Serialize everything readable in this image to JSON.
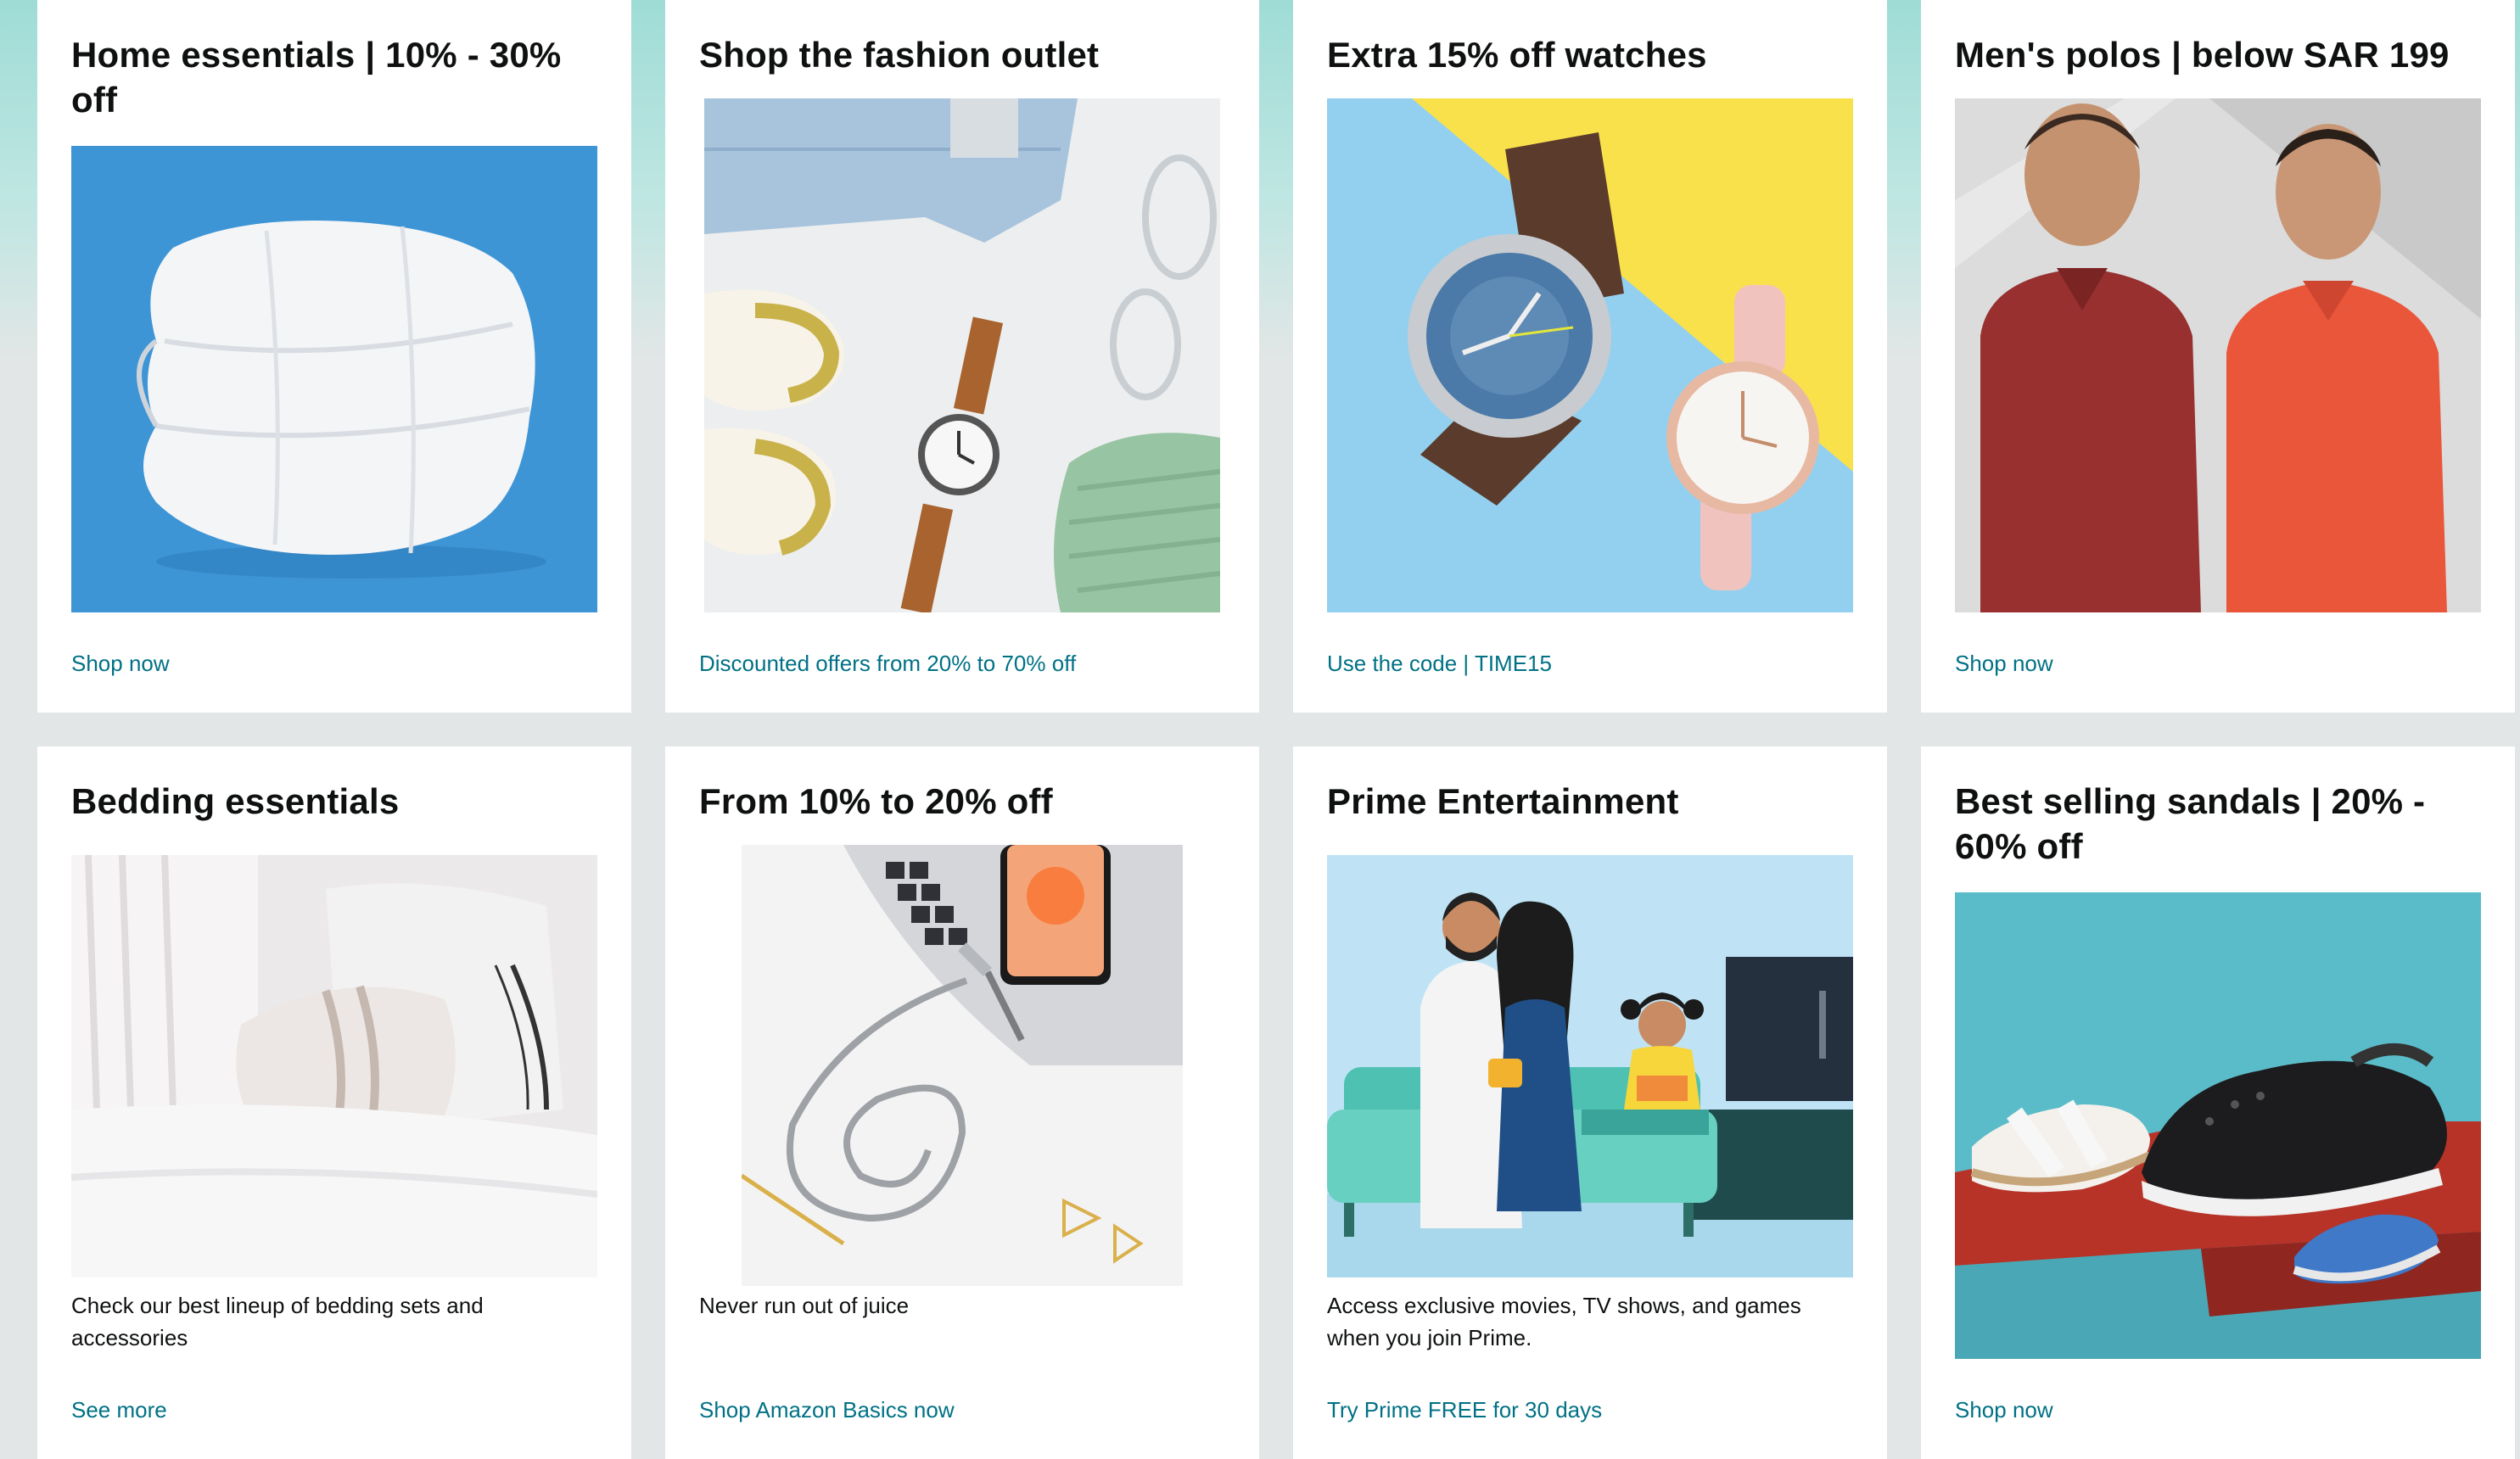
{
  "cards": [
    {
      "title": "Home essentials | 10% - 30% off",
      "link": "Shop now",
      "image": "white comforter on blue background"
    },
    {
      "title": "Shop the fashion outlet",
      "link": "Discounted offers from 20% to 70% off",
      "image": "jeans, sneakers, watch, glasses and sweater flat lay"
    },
    {
      "title": "Extra 15% off watches",
      "link": "Use the code | TIME15",
      "image": "two wristwatches on blue and yellow background"
    },
    {
      "title": "Men's polos | below SAR 199",
      "link": "Shop now",
      "image": "two men wearing polo shirts"
    },
    {
      "title": "Bedding essentials",
      "desc": "Check our best lineup of bedding sets and accessories",
      "link": "See more",
      "image": "bed with white pillows and sheets"
    },
    {
      "title": "From 10% to 20% off",
      "desc": "Never run out of juice",
      "link": "Shop Amazon Basics now",
      "image": "phone charging cable with laptop"
    },
    {
      "title": "Prime Entertainment",
      "desc": "Access exclusive movies, TV shows, and games when you join Prime.",
      "link": "Try Prime FREE for 30 days",
      "image": "family watching TV on sofa"
    },
    {
      "title": "Best selling sandals | 20% - 60% off",
      "link": "Shop now",
      "image": "sandals and clogs on red and teal background"
    }
  ],
  "colors": {
    "link": "#007185",
    "text": "#0f1111",
    "page_bg": "#e3e6e6",
    "hero": "#9fdcd6"
  }
}
